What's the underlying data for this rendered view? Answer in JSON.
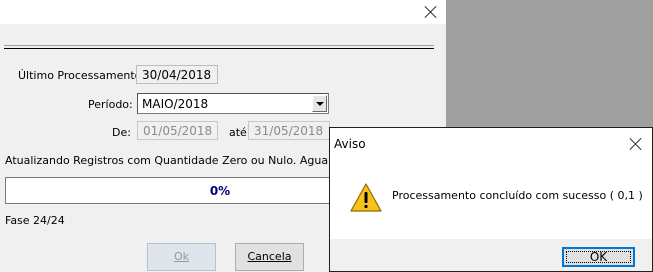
{
  "main": {
    "ultimo_label": "Último Processamento:",
    "ultimo_value": "30/04/2018",
    "periodo_label": "Período:",
    "periodo_value": "MAIO/2018",
    "de_label": "De:",
    "de_value": "01/05/2018",
    "ate_label": "até",
    "ate_value": "31/05/2018",
    "status_text": "Atualizando Registros com Quantidade Zero ou Nulo. Aguarde...",
    "progress_text": "0%",
    "progress_value": 0,
    "fase_text": "Fase 24/24",
    "ok_label": "Ok",
    "cancel_label": "Cancela"
  },
  "msgbox": {
    "title": "Aviso",
    "message": "Processamento concluído com sucesso ( 0,1 )",
    "ok_label": "OK",
    "icon": "warning-icon"
  },
  "colors": {
    "progress_text": "#000080",
    "dialog_bg": "#f0f0f0",
    "desktop_bg": "#a0a0a0"
  }
}
